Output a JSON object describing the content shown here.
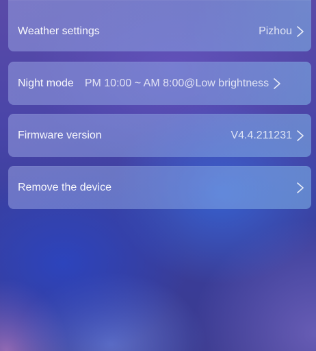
{
  "settings": {
    "rows": [
      {
        "label": "Weather settings",
        "value": "Pizhou",
        "chevron": "chevron-right-icon"
      },
      {
        "label": "Night mode",
        "value": "PM 10:00 ~ AM 8:00@Low brightness",
        "chevron": "chevron-right-icon"
      },
      {
        "label": "Firmware version",
        "value": "V4.4.211231",
        "chevron": "chevron-right-icon"
      },
      {
        "label": "Remove the device",
        "value": "",
        "chevron": "chevron-right-icon"
      }
    ]
  },
  "colors": {
    "row_fill": "#8fa0e0",
    "text": "#ffffff",
    "background_top": "#5a4aa8",
    "background_bottom": "#3a3a8f"
  }
}
